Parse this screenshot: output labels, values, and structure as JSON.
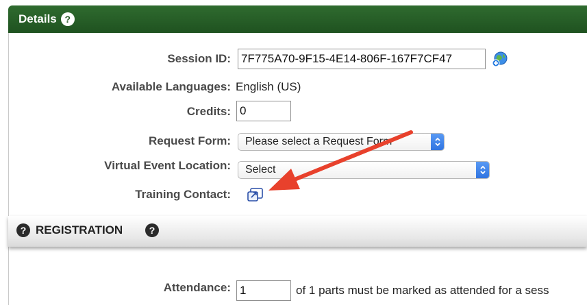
{
  "details": {
    "title": "Details",
    "help_glyph": "?"
  },
  "form": {
    "session_id_label": "Session ID:",
    "session_id_value": "7F775A70-9F15-4E14-806F-167F7CF47",
    "languages_label": "Available Languages:",
    "languages_value": "English (US)",
    "credits_label": "Credits:",
    "credits_value": "0",
    "request_form_label": "Request Form:",
    "request_form_selected": "Please select a Request Form",
    "virtual_location_label": "Virtual Event Location:",
    "virtual_location_selected": "Select",
    "training_contact_label": "Training Contact:"
  },
  "registration": {
    "title": "REGISTRATION",
    "help_glyph": "?"
  },
  "attendance": {
    "label": "Attendance:",
    "value": "1",
    "suffix": "of 1 parts must be marked as attended for a sess"
  },
  "icons": {
    "session_globe": "globe-add-icon",
    "training_contact": "open-external-icon",
    "annotation": "red-arrow-annotation"
  },
  "colors": {
    "header_green": "#2a5d2a",
    "arrow_red": "#e8412c",
    "select_blue": "#2f73e0"
  }
}
